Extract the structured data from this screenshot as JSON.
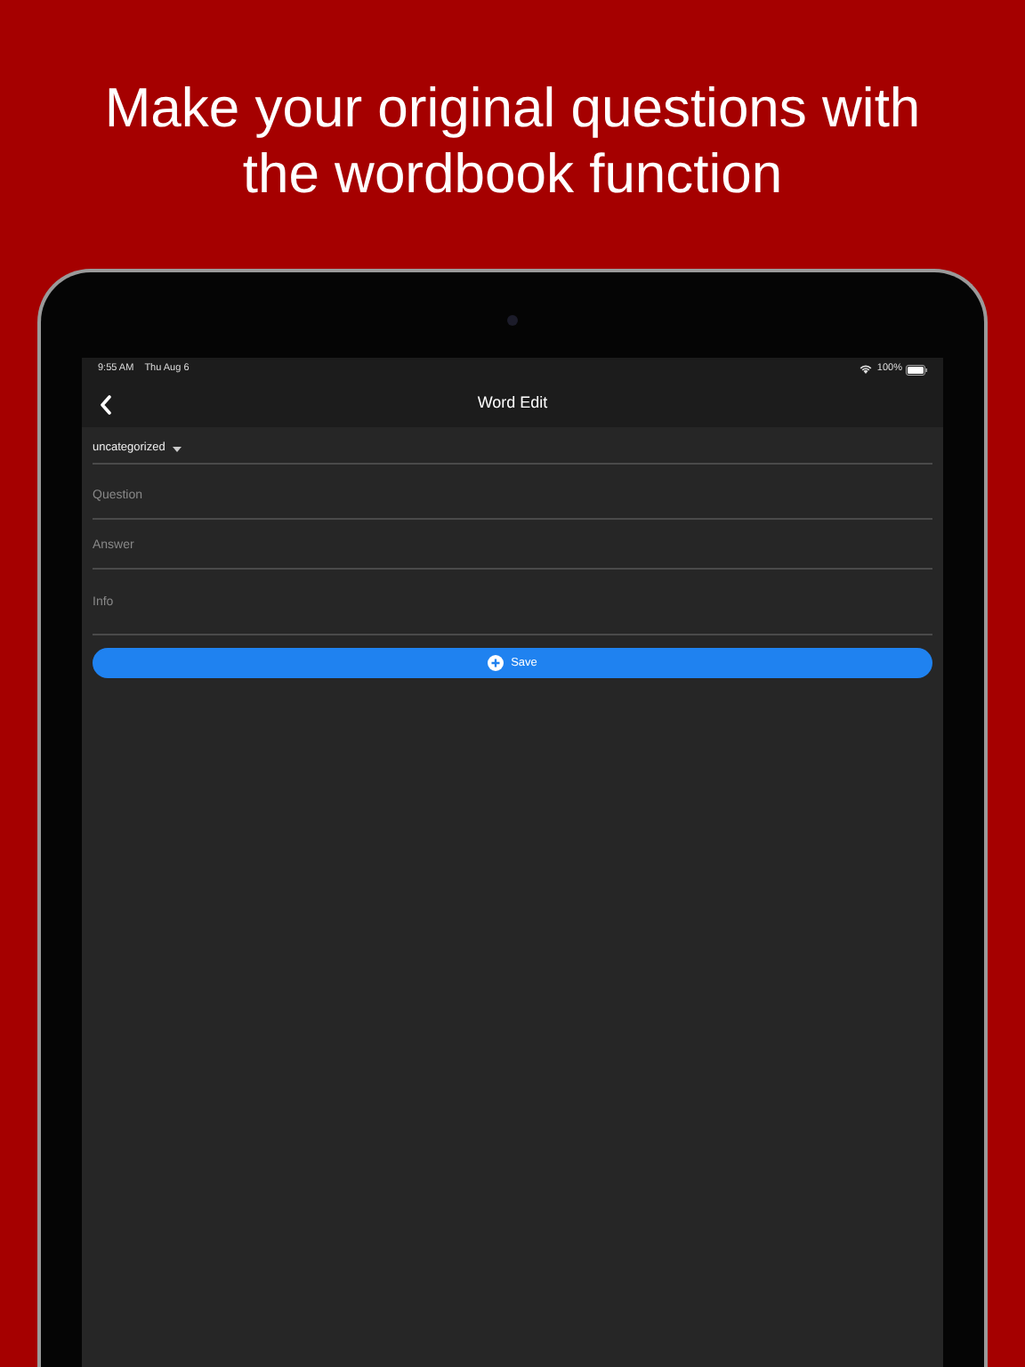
{
  "headline": "Make your original questions with the wordbook function",
  "status_bar": {
    "time": "9:55 AM",
    "date": "Thu Aug 6",
    "battery": "100%"
  },
  "nav_bar": {
    "title": "Word Edit"
  },
  "category": {
    "value": "uncategorized"
  },
  "fields": [
    {
      "placeholder": "Question",
      "kind": "line"
    },
    {
      "placeholder": "Answer",
      "kind": "line"
    },
    {
      "placeholder": "Info",
      "kind": "tall"
    }
  ],
  "save_button": {
    "label": "Save"
  }
}
